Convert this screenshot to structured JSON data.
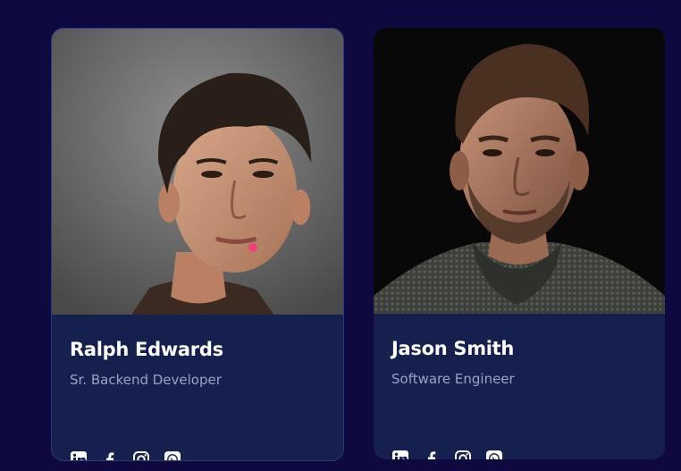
{
  "team": [
    {
      "name": "Ralph Edwards",
      "role": "Sr. Backend Developer",
      "photo_icon": "person-portrait",
      "socials": [
        "linkedin-icon",
        "facebook-icon",
        "instagram-icon",
        "whatsapp-icon"
      ]
    },
    {
      "name": "Jason Smith",
      "role": "Software Engineer",
      "photo_icon": "person-portrait",
      "socials": [
        "linkedin-icon",
        "facebook-icon",
        "instagram-icon",
        "whatsapp-icon"
      ]
    }
  ],
  "colors": {
    "background": "#0e0a40",
    "card": "#16204f",
    "card_border": "#2b3a7c",
    "name": "#ffffff",
    "role": "#9aa2c6",
    "accent_dot": "#f1427c"
  }
}
